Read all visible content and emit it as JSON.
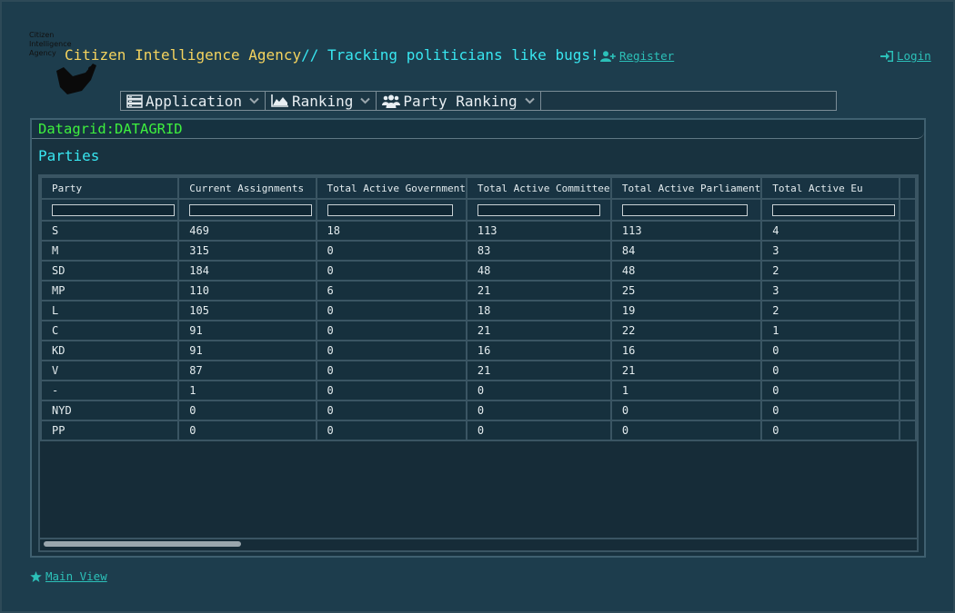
{
  "header": {
    "logo_lines": [
      "Citizen",
      "Intelligence",
      "Agency"
    ],
    "title_name": "Citizen Intelligence Agency",
    "title_tagline": "// Tracking politicians like bugs!",
    "register_label": "Register",
    "login_label": "Login"
  },
  "menu": [
    {
      "label": "Application",
      "icon": "server-icon"
    },
    {
      "label": "Ranking",
      "icon": "area-chart-icon"
    },
    {
      "label": "Party Ranking",
      "icon": "users-icon"
    }
  ],
  "panel": {
    "header": "Datagrid:DATAGRID",
    "section_title": "Parties"
  },
  "grid": {
    "columns": [
      "Party",
      "Current Assignments",
      "Total Active Government",
      "Total Active Committee",
      "Total Active Parliament",
      "Total Active Eu"
    ],
    "rows": [
      [
        "S",
        "469",
        "18",
        "113",
        "113",
        "4"
      ],
      [
        "M",
        "315",
        "0",
        "83",
        "84",
        "3"
      ],
      [
        "SD",
        "184",
        "0",
        "48",
        "48",
        "2"
      ],
      [
        "MP",
        "110",
        "6",
        "21",
        "25",
        "3"
      ],
      [
        "L",
        "105",
        "0",
        "18",
        "19",
        "2"
      ],
      [
        "C",
        "91",
        "0",
        "21",
        "22",
        "1"
      ],
      [
        "KD",
        "91",
        "0",
        "16",
        "16",
        "0"
      ],
      [
        "V",
        "87",
        "0",
        "21",
        "21",
        "0"
      ],
      [
        "-",
        "1",
        "0",
        "0",
        "1",
        "0"
      ],
      [
        "NYD",
        "0",
        "0",
        "0",
        "0",
        "0"
      ],
      [
        "PP",
        "0",
        "0",
        "0",
        "0",
        "0"
      ]
    ]
  },
  "footer": {
    "main_view_label": "Main View"
  },
  "colors": {
    "background": "#1d3d4d",
    "title_yellow": "#f4d35e",
    "title_cyan": "#38e6f0",
    "panel_header_green": "#3ef03e",
    "link_teal": "#2cc0b8"
  }
}
